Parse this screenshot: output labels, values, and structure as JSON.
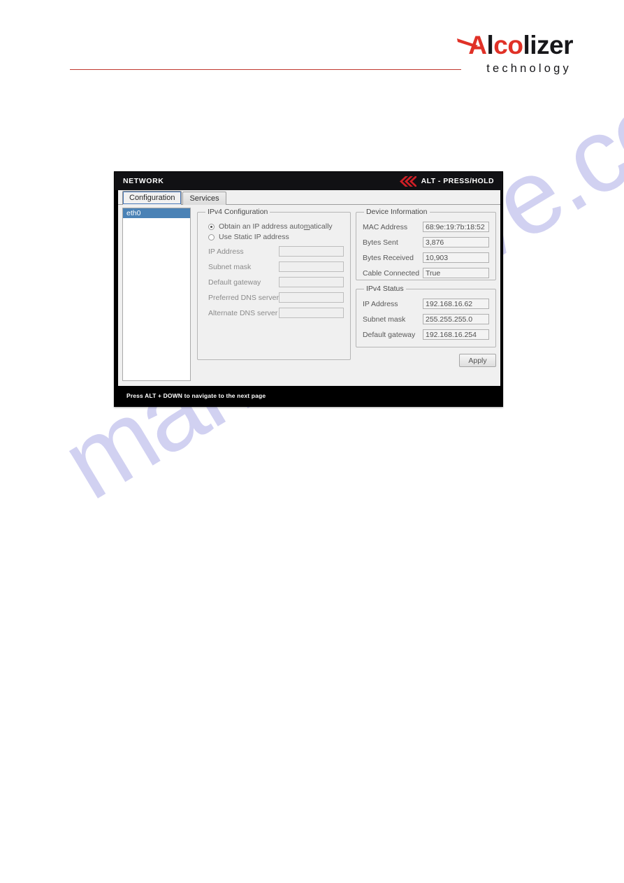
{
  "brand": {
    "wordmark_prefix": "A",
    "wordmark_l": "l",
    "wordmark_co": "co",
    "wordmark_suffix": "lizer",
    "tagline": "technology",
    "accent_color": "#e03127",
    "rule_color": "#c0392f"
  },
  "watermark": {
    "text": "manualshive.com",
    "color": "#c9c9ef"
  },
  "window": {
    "title": "NETWORK",
    "alt_hint": "ALT - PRESS/HOLD",
    "chevron_color": "#cf1f26",
    "statusbar": "Press ALT + DOWN to navigate to the next page"
  },
  "tabs": [
    {
      "label": "Configuration",
      "selected": true
    },
    {
      "label": "Services",
      "selected": false
    }
  ],
  "interfaces": {
    "items": [
      {
        "name": "eth0",
        "selected": true
      }
    ],
    "selection_color": "#4a82b6"
  },
  "ipv4_configuration": {
    "legend": "IPv4 Configuration",
    "radios": [
      {
        "label_before": "Obtain an IP address auto",
        "mnemonic": "m",
        "label_after": "atically",
        "checked": true
      },
      {
        "label_before": "Use Static IP address",
        "mnemonic": "",
        "label_after": "",
        "checked": false
      }
    ],
    "fields": [
      {
        "label": "IP Address",
        "value": ""
      },
      {
        "label": "Subnet mask",
        "value": ""
      },
      {
        "label": "Default gateway",
        "value": ""
      },
      {
        "label": "Preferred DNS server",
        "value": ""
      },
      {
        "label": "Alternate DNS server",
        "value": ""
      }
    ]
  },
  "device_information": {
    "legend": "Device Information",
    "fields": [
      {
        "label": "MAC Address",
        "value": "68:9e:19:7b:18:52"
      },
      {
        "label": "Bytes Sent",
        "value": "3,876"
      },
      {
        "label": "Bytes Received",
        "value": "10,903"
      },
      {
        "label": "Cable Connected",
        "value": "True"
      }
    ]
  },
  "ipv4_status": {
    "legend": "IPv4 Status",
    "fields": [
      {
        "label": "IP Address",
        "value": "192.168.16.62"
      },
      {
        "label": "Subnet mask",
        "value": "255.255.255.0"
      },
      {
        "label": "Default gateway",
        "value": "192.168.16.254"
      }
    ]
  },
  "actions": {
    "apply_label": "Apply"
  }
}
